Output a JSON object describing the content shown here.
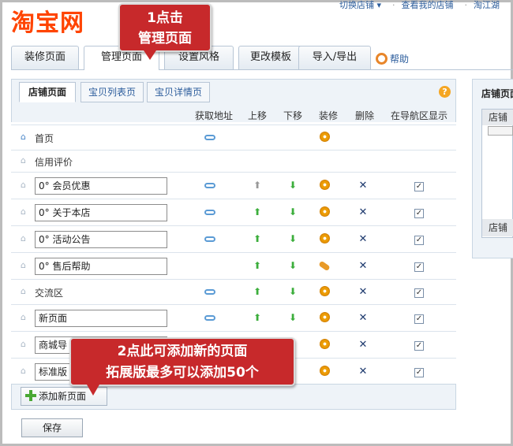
{
  "header": {
    "logo_text": "淘宝网",
    "links": [
      "切换店铺 ▾",
      "查看我的店铺",
      "淘江湖"
    ]
  },
  "main_tabs": [
    {
      "label": "装修页面"
    },
    {
      "label": "管理页面"
    },
    {
      "label": "设置风格"
    },
    {
      "label": "更改模板"
    },
    {
      "label": "导入/导出"
    }
  ],
  "help_label": "帮助",
  "sub_tabs": [
    {
      "label": "店铺页面"
    },
    {
      "label": "宝贝列表页"
    },
    {
      "label": "宝贝详情页"
    }
  ],
  "columns": [
    "获取地址",
    "上移",
    "下移",
    "装修",
    "删除",
    "在导航区显示"
  ],
  "rows": [
    {
      "name": "首页",
      "type": "static",
      "link": true,
      "up": "",
      "down": "",
      "decorate": "gear",
      "del": false,
      "show": false
    },
    {
      "name": "信用评价",
      "type": "static",
      "link": false,
      "up": "",
      "down": "",
      "decorate": "",
      "del": false,
      "show": false
    },
    {
      "name": "0° 会员优惠",
      "type": "input",
      "link": true,
      "up": "gray",
      "down": "green",
      "decorate": "gear",
      "del": true,
      "show": true
    },
    {
      "name": "0° 关于本店",
      "type": "input",
      "link": true,
      "up": "green",
      "down": "green",
      "decorate": "gear",
      "del": true,
      "show": true
    },
    {
      "name": "0° 活动公告",
      "type": "input",
      "link": true,
      "up": "green",
      "down": "green",
      "decorate": "gear",
      "del": true,
      "show": true
    },
    {
      "name": "0° 售后帮助",
      "type": "input",
      "link": false,
      "up": "green",
      "down": "green",
      "decorate": "pill",
      "del": true,
      "show": true
    },
    {
      "name": "交流区",
      "type": "static",
      "link": true,
      "up": "green",
      "down": "green",
      "decorate": "gear",
      "del": true,
      "show": true
    },
    {
      "name": "新页面",
      "type": "input",
      "link": true,
      "up": "green",
      "down": "green",
      "decorate": "gear",
      "del": true,
      "show": true
    },
    {
      "name": "商城导",
      "type": "input",
      "link": false,
      "up": "",
      "down": "",
      "decorate": "gear",
      "del": true,
      "show": true
    },
    {
      "name": "标准版",
      "type": "input",
      "link": false,
      "up": "",
      "down": "",
      "decorate": "gear",
      "del": true,
      "show": true
    }
  ],
  "add_page_label": "添加新页面",
  "save_label": "保存",
  "side_panel": {
    "title": "店铺页面",
    "header": "店铺",
    "footer": "店铺"
  },
  "callouts": [
    {
      "line1": "1点击",
      "line2": "管理页面"
    },
    {
      "line1": "2点此可添加新的页面",
      "line2": "拓展版最多可以添加50个"
    }
  ],
  "colors": {
    "brand": "#ff4400",
    "callout": "#c7292b",
    "panel": "#eef3f8"
  }
}
